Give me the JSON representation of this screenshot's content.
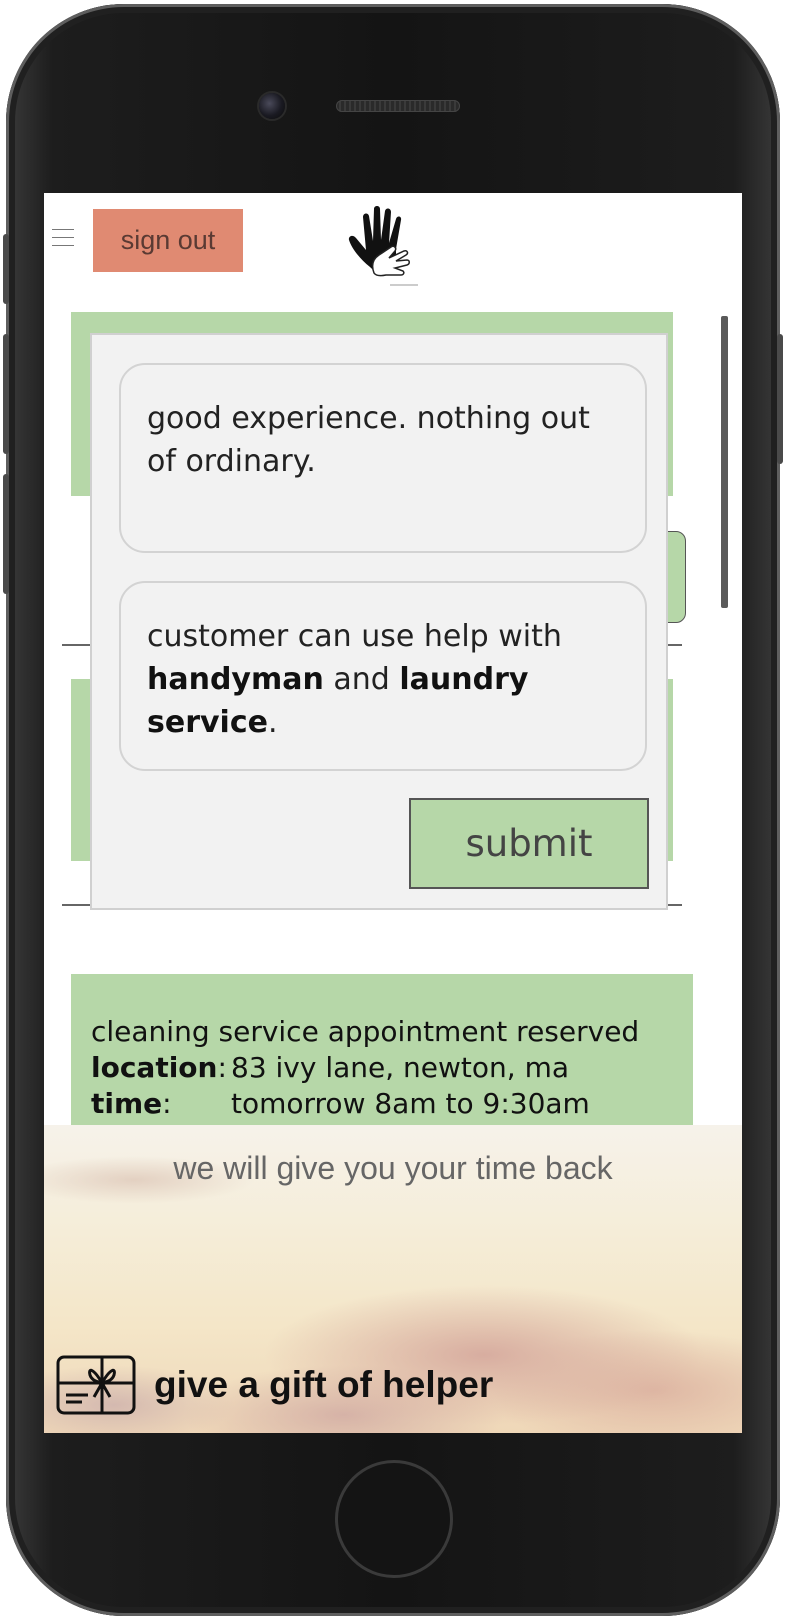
{
  "header": {
    "sign_out_label": "sign out"
  },
  "feedback": {
    "comment_text": "good experience. nothing out of ordinary.",
    "note_prefix": "customer can use help with ",
    "note_service_1": "handyman",
    "note_joiner": " and ",
    "note_service_2": "laundry service",
    "note_suffix": ".",
    "submit_label": "submit"
  },
  "appointment": {
    "title": "cleaning service appointment reserved",
    "location_label": "location",
    "location_value": "83 ivy lane, newton, ma",
    "time_label": "time",
    "time_value": "tomorrow 8am to 9:30am",
    "separator": ":"
  },
  "banner": {
    "tagline": "we will give you your time back",
    "gift_label": "give a gift of helper",
    "gift_icon": "gift-card-icon"
  },
  "colors": {
    "accent_green": "#b6d7a8",
    "sign_out_bg": "#e08a72"
  }
}
